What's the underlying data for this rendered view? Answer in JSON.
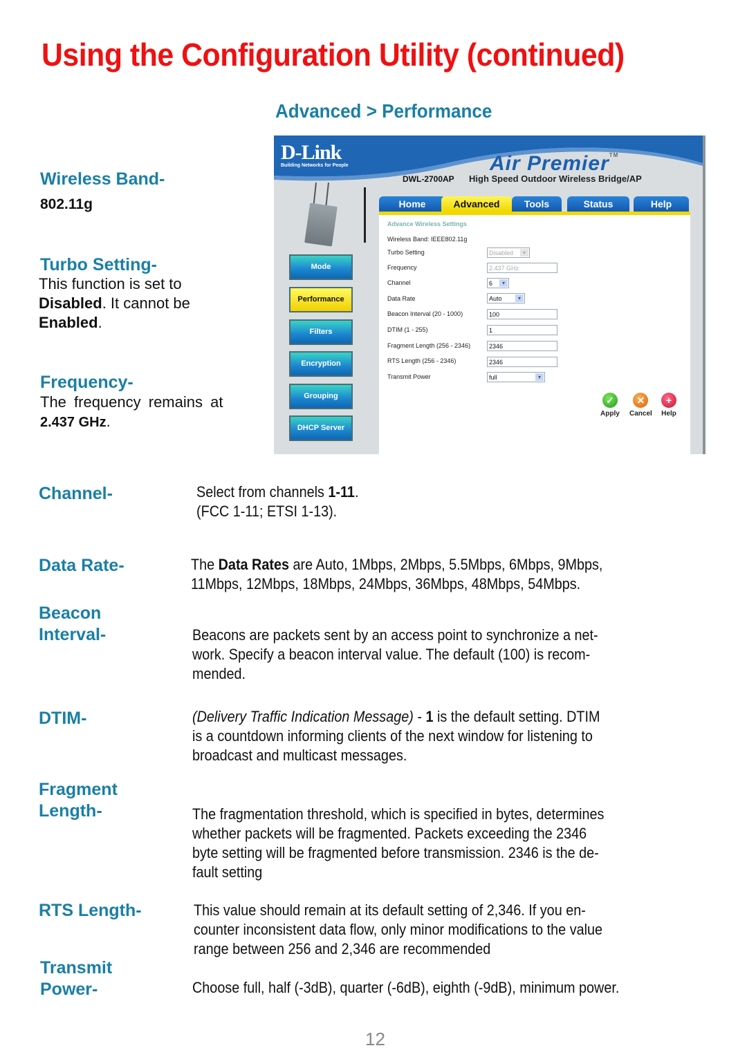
{
  "page": {
    "title": "Using the Configuration Utility (continued)",
    "section_title": "Advanced > Performance",
    "page_number": "12"
  },
  "side_notes": {
    "wireless_band": {
      "label": "Wireless Band-",
      "value": "802.11g"
    },
    "turbo_setting": {
      "label": "Turbo Setting-",
      "line1": "This function is set to",
      "bold1": "Disabled",
      "line2": ". It cannot be",
      "bold2": "Enabled",
      "end": "."
    },
    "frequency": {
      "label": "Frequency-",
      "line1": "The frequency remains at",
      "bold": "2.437 GHz",
      "end": "."
    }
  },
  "definitions": {
    "channel": {
      "label": "Channel-",
      "pre": "Select from channels ",
      "bold": "1-11",
      "post": ".",
      "line2": "(FCC 1-11; ETSI 1-13)."
    },
    "data_rate": {
      "label": "Data Rate-",
      "pre": "The ",
      "bold": "Data Rates",
      "post": " are Auto, 1Mbps, 2Mbps, 5.5Mbps, 6Mbps, 9Mbps,",
      "line2": "11Mbps, 12Mbps, 18Mbps, 24Mbps, 36Mbps, 48Mbps, 54Mbps."
    },
    "beacon_interval": {
      "label1": "Beacon",
      "label2": "Interval-",
      "line1": "Beacons are packets sent by an access point to synchronize a net-",
      "line2": "work. Specify a beacon interval value. The default (100) is recom-",
      "line3": "mended."
    },
    "dtim": {
      "label": "DTIM-",
      "italic": "(Delivery Traffic Indication Message)",
      "mid": " - ",
      "bold": "1",
      "post": " is the default setting. DTIM",
      "line2": "is a countdown informing clients of the next window for listening to",
      "line3": "broadcast and multicast messages."
    },
    "fragment_length": {
      "label1": "Fragment",
      "label2": "Length-",
      "line1": "The fragmentation threshold, which is specified in bytes, determines",
      "line2": "whether packets will be fragmented. Packets exceeding the 2346",
      "line3": "byte setting will be fragmented before transmission. 2346 is the de-",
      "line4": "fault setting"
    },
    "rts_length": {
      "label": "RTS Length-",
      "line1": "This value should remain at its default setting of 2,346. If you en-",
      "line2": "counter inconsistent data flow, only minor modifications to the value",
      "line3": "range between 256 and 2,346 are recommended"
    },
    "transmit_power": {
      "label1": "Transmit",
      "label2": "Power-",
      "line1": "Choose full, half (-3dB), quarter (-6dB), eighth (-9dB), minimum power."
    }
  },
  "screenshot": {
    "brand": "D-Link",
    "brand_tagline": "Building Networks for People",
    "product_line": "Air Premier",
    "trademark": "TM",
    "model": "DWL-2700AP",
    "model_desc": "High Speed Outdoor Wireless Bridge/AP",
    "tabs": [
      "Home",
      "Advanced",
      "Tools",
      "Status",
      "Help"
    ],
    "active_tab": "Advanced",
    "nav": [
      "Mode",
      "Performance",
      "Filters",
      "Encryption",
      "Grouping",
      "DHCP Server"
    ],
    "active_nav": "Performance",
    "form_title": "Advance Wireless Settings",
    "wireless_band_label": "Wireless Band:",
    "wireless_band_value": "IEEE802.11g",
    "fields": {
      "turbo": {
        "label": "Turbo Setting",
        "value": "Disabled"
      },
      "frequency": {
        "label": "Frequency",
        "value": "2.437 GHz"
      },
      "channel": {
        "label": "Channel",
        "value": "6"
      },
      "data_rate": {
        "label": "Data Rate",
        "value": "Auto"
      },
      "beacon": {
        "label": "Beacon Interval (20 - 1000)",
        "value": "100"
      },
      "dtim": {
        "label": "DTIM (1 - 255)",
        "value": "1"
      },
      "fragment": {
        "label": "Fragment Length (256 - 2346)",
        "value": "2346"
      },
      "rts": {
        "label": "RTS Length (256 - 2346)",
        "value": "2346"
      },
      "tx_power": {
        "label": "Transmit Power",
        "value": "full"
      }
    },
    "actions": {
      "apply": "Apply",
      "cancel": "Cancel",
      "help": "Help"
    }
  },
  "colors": {
    "title_red": "#ee1111",
    "heading_teal": "#1a7fa6",
    "tab_yellow": "#f0d800",
    "tab_blue": "#1358b0"
  }
}
